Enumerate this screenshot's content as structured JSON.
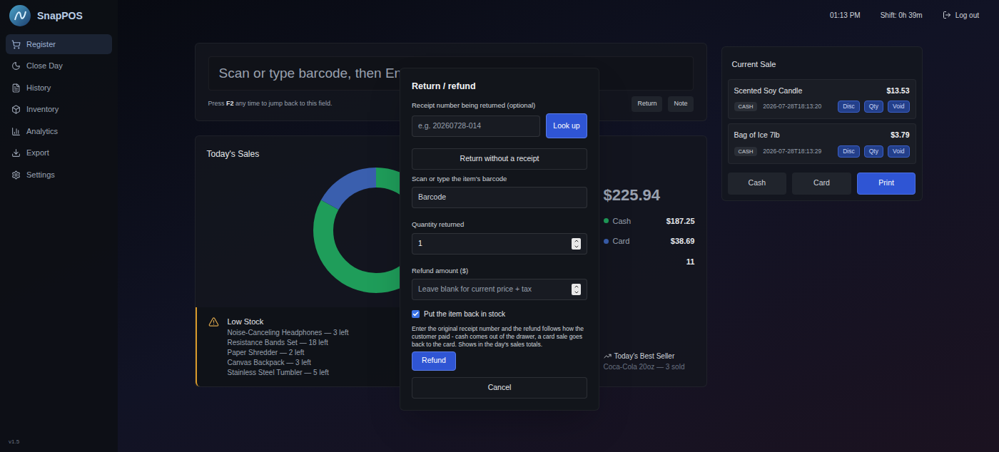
{
  "app": {
    "name": "SnapPOS",
    "version": "v1.5"
  },
  "topbar": {
    "time": "01:13 PM",
    "shift": "Shift: 0h 39m",
    "logout": "Log out"
  },
  "sidebar": {
    "items": [
      {
        "label": "Register",
        "selected": true
      },
      {
        "label": "Close Day",
        "selected": false
      },
      {
        "label": "History",
        "selected": false
      },
      {
        "label": "Inventory",
        "selected": false
      },
      {
        "label": "Analytics",
        "selected": false
      },
      {
        "label": "Export",
        "selected": false
      },
      {
        "label": "Settings",
        "selected": false
      }
    ]
  },
  "scan": {
    "placeholder": "Scan or type barcode, then Enter",
    "hint_before": "Press ",
    "hint_key": "F2",
    "hint_after": " any time to jump back to this field.",
    "buttons": [
      "Return",
      "Note"
    ]
  },
  "today": {
    "title": "Today's Sales",
    "total": "$225.94",
    "series": [
      {
        "label": "Cash",
        "value": 187.25,
        "amount": "$187.25",
        "color": "#1f9d5a"
      },
      {
        "label": "Card",
        "value": 38.69,
        "amount": "$38.69",
        "color": "#3a5fae"
      }
    ],
    "count": "11",
    "best_seller": {
      "title": "Today's Best Seller",
      "value": "Coca-Cola 20oz — 3 sold"
    }
  },
  "low_stock": {
    "title": "Low Stock",
    "items": [
      "Noise-Canceling Headphones — 3 left",
      "Resistance Bands Set — 18 left",
      "Paper Shredder — 2 left",
      "Canvas Backpack — 3 left",
      "Stainless Steel Tumbler — 5 left"
    ]
  },
  "current_sale": {
    "title": "Current Sale",
    "items": [
      {
        "name": "Scented Soy Candle",
        "price": "$13.53",
        "tag": "CASH",
        "time": "2026-07-28T18:13:20",
        "actions": [
          "Disc",
          "Qty",
          "Void"
        ]
      },
      {
        "name": "Bag of Ice 7lb",
        "price": "$3.79",
        "tag": "CASH",
        "time": "2026-07-28T18:13:29",
        "actions": [
          "Disc",
          "Qty",
          "Void"
        ]
      }
    ],
    "buttons": [
      {
        "label": "Cash",
        "primary": false
      },
      {
        "label": "Card",
        "primary": false
      },
      {
        "label": "Print",
        "primary": true
      }
    ]
  },
  "modal": {
    "title": "Return / refund",
    "receipt_label": "Receipt number being returned (optional)",
    "receipt_placeholder": "e.g. 20260728-014",
    "lookup": "Look up",
    "no_receipt": "Return without a receipt",
    "barcode_label": "Scan or type the item's barcode",
    "barcode_placeholder": "Barcode",
    "qty_label": "Quantity returned",
    "qty_value": "1",
    "amount_label": "Refund amount ($)",
    "amount_placeholder": "Leave blank for current price + tax",
    "restock_label": "Put the item back in stock",
    "restock_checked": true,
    "help": "Enter the original receipt number and the refund follows how the customer paid - cash comes out of the drawer, a card sale goes back to the card. Shows in the day's sales totals.",
    "refund": "Refund",
    "cancel": "Cancel"
  }
}
